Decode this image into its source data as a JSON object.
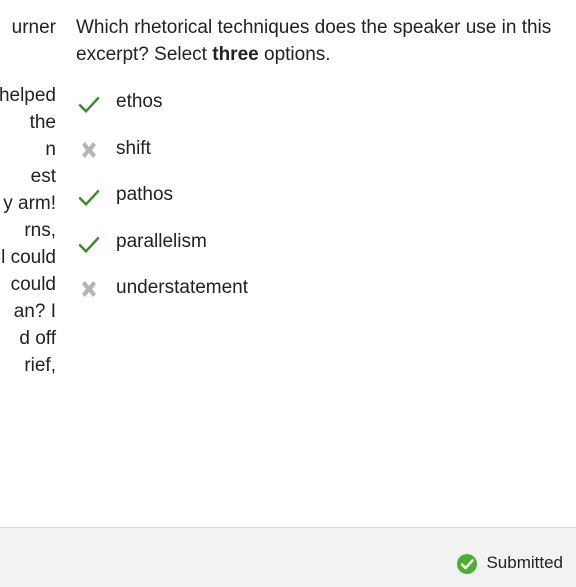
{
  "passage": {
    "lines": [
      "urner",
      "",
      "helped",
      "the",
      "n",
      "est",
      "y arm!",
      "rns,",
      "l could",
      "could",
      "an? I",
      "d off",
      "rief,"
    ]
  },
  "question": {
    "prefix": "Which rhetorical techniques does the speaker use in this excerpt? Select ",
    "emphasis": "three",
    "suffix": " options."
  },
  "options": [
    {
      "label": "ethos",
      "state": "correct",
      "icon": "check-icon"
    },
    {
      "label": "shift",
      "state": "incorrect",
      "icon": "x-icon"
    },
    {
      "label": "pathos",
      "state": "correct",
      "icon": "check-icon"
    },
    {
      "label": "parallelism",
      "state": "correct",
      "icon": "check-icon"
    },
    {
      "label": "understatement",
      "state": "incorrect",
      "icon": "x-icon"
    }
  ],
  "footer": {
    "status_text": "Submitted",
    "status_icon": "check-circle-icon"
  },
  "colors": {
    "correct": "#3a8a2a",
    "incorrect": "#b5b5b5",
    "badge": "#4caf2f",
    "footer_bg": "#f2f2f2"
  }
}
